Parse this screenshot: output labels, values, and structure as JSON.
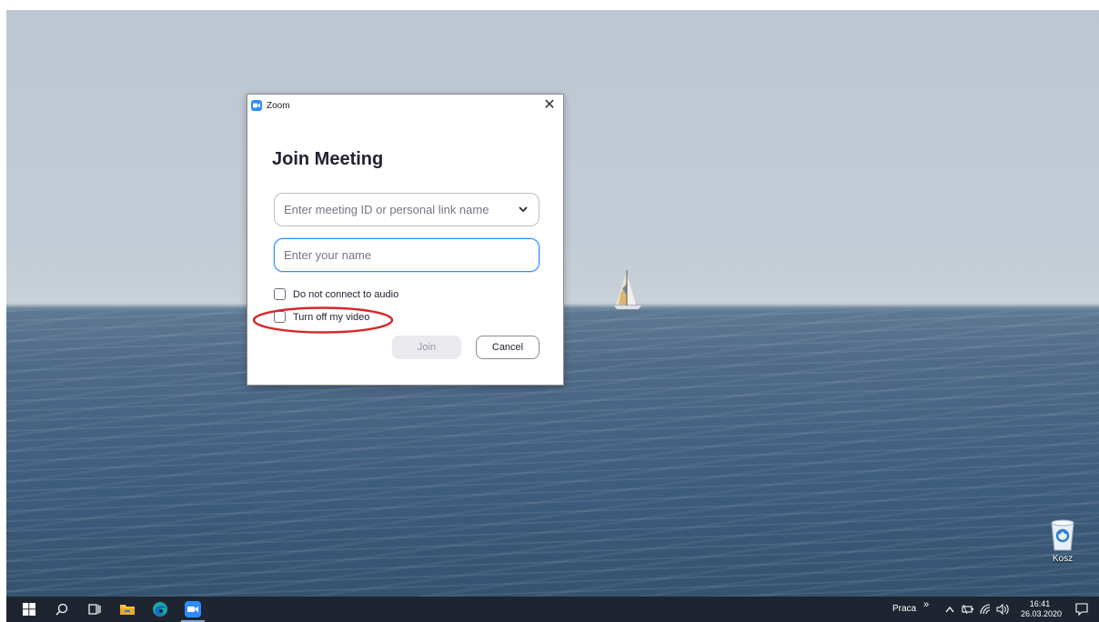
{
  "dialog": {
    "title": "Zoom",
    "close_glyph": "✕",
    "heading": "Join Meeting",
    "meeting_field": {
      "placeholder": "Enter meeting ID or personal link name",
      "value": ""
    },
    "name_field": {
      "placeholder": "Enter your name",
      "value": ""
    },
    "audio_checkbox": {
      "label": "Do not connect to audio",
      "checked": false
    },
    "video_checkbox": {
      "label": "Turn off my video",
      "checked": false,
      "highlighted": true
    },
    "join_label": "Join",
    "cancel_label": "Cancel"
  },
  "desktop": {
    "recycle_bin_label": "Kosz"
  },
  "taskbar": {
    "apps": [
      "windows-start-icon",
      "search-icon",
      "task-view-icon",
      "file-explorer-icon",
      "edge-icon",
      "zoom-icon"
    ],
    "tray_label": "Praca",
    "overflow_glyph": "»",
    "time": "16:41",
    "date": "26.03.2020"
  },
  "colors": {
    "zoom_blue": "#2d8cff",
    "highlight_red": "#d42a2a",
    "taskbar_bg": "#1f2530"
  }
}
